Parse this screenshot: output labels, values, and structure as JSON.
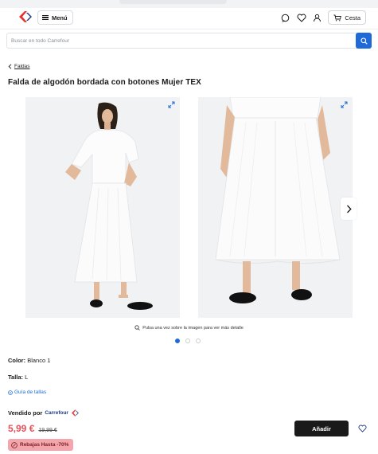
{
  "header": {
    "menu_label": "Menú",
    "cart_label": "Cesta"
  },
  "search": {
    "placeholder": "Buscar en todo Carrefour"
  },
  "breadcrumb": {
    "label": "Faldas"
  },
  "product": {
    "title": "Falda de algodón bordada con botones Mujer TEX",
    "gallery_hint": "Pulsa una vez sobre la imagen para ver más detalle",
    "color_label": "Color:",
    "color_value": "Blanco 1",
    "size_label": "Talla:",
    "size_value": "L",
    "size_guide": "Guía de tallas",
    "sold_by_label": "Vendido por",
    "seller": "Carrefour",
    "price_now": "5,99 €",
    "price_was": "19,99 €",
    "promo": "Rebajas Hasta -70%",
    "add_button": "Añadir"
  },
  "gallery": {
    "dots": 3,
    "active_index": 0
  },
  "colors": {
    "accent_blue": "#1f6ad8",
    "price_red": "#e3545c",
    "promo_bg": "#f3a7ad",
    "button_dark": "#1a1a1a"
  },
  "icons": [
    "carrefour-logo",
    "hamburger-icon",
    "chat-icon",
    "heart-icon",
    "user-icon",
    "cart-icon",
    "search-icon",
    "chevron-left-icon",
    "expand-icon",
    "chevron-right-icon",
    "zoom-icon",
    "ruler-icon",
    "percent-icon"
  ]
}
